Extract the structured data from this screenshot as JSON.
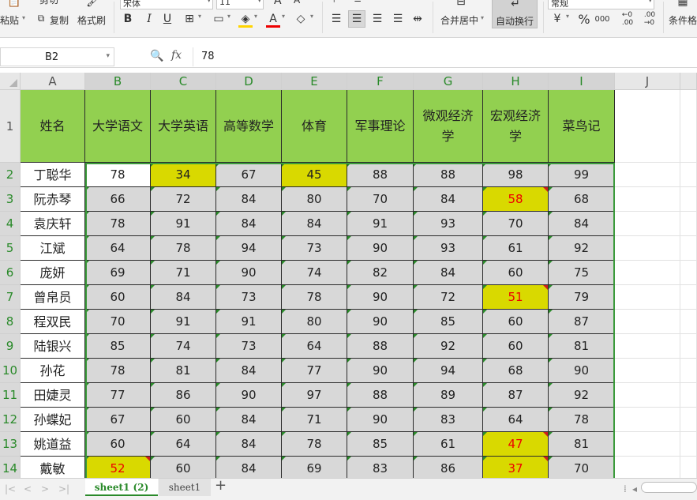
{
  "ribbon": {
    "paste_label": "粘贴",
    "cut_label": "剪切",
    "copy_label": "复制",
    "format_painter_label": "格式刷",
    "font_name": "宋体",
    "font_size": "11",
    "merge_center_label": "合并居中",
    "wrap_text_label": "自动换行",
    "number_format": "常规",
    "percent_symbol": "%",
    "cond_format_label": "条件格"
  },
  "formula_bar": {
    "name_box": "B2",
    "fx_label": "fx",
    "value": "78"
  },
  "columns": [
    "A",
    "B",
    "C",
    "D",
    "E",
    "F",
    "G",
    "H",
    "I",
    "J"
  ],
  "rows": [
    "1",
    "2",
    "3",
    "4",
    "5",
    "6",
    "7",
    "8",
    "9",
    "10",
    "11",
    "12",
    "13",
    "14"
  ],
  "headers": [
    "姓名",
    "大学语文",
    "大学英语",
    "高等数学",
    "体育",
    "军事理论",
    "微观经济学",
    "宏观经济学",
    "菜鸟记"
  ],
  "data": [
    {
      "name": "丁聪华",
      "scores": [
        "78",
        "34",
        "67",
        "45",
        "88",
        "88",
        "98",
        "99"
      ]
    },
    {
      "name": "阮赤琴",
      "scores": [
        "66",
        "72",
        "84",
        "80",
        "70",
        "84",
        "58",
        "68"
      ]
    },
    {
      "name": "袁庆轩",
      "scores": [
        "78",
        "91",
        "84",
        "84",
        "91",
        "93",
        "70",
        "84"
      ]
    },
    {
      "name": "江斌",
      "scores": [
        "64",
        "78",
        "94",
        "73",
        "90",
        "93",
        "61",
        "92"
      ]
    },
    {
      "name": "庞妍",
      "scores": [
        "69",
        "71",
        "90",
        "74",
        "82",
        "84",
        "60",
        "75"
      ]
    },
    {
      "name": "曾帛员",
      "scores": [
        "60",
        "84",
        "73",
        "78",
        "90",
        "72",
        "51",
        "79"
      ]
    },
    {
      "name": "程双民",
      "scores": [
        "70",
        "91",
        "91",
        "80",
        "90",
        "85",
        "60",
        "87"
      ]
    },
    {
      "name": "陆银兴",
      "scores": [
        "85",
        "74",
        "73",
        "64",
        "88",
        "92",
        "60",
        "81"
      ]
    },
    {
      "name": "孙花",
      "scores": [
        "78",
        "81",
        "84",
        "77",
        "90",
        "94",
        "68",
        "90"
      ]
    },
    {
      "name": "田婕灵",
      "scores": [
        "77",
        "86",
        "90",
        "97",
        "88",
        "89",
        "87",
        "92"
      ]
    },
    {
      "name": "孙蝶妃",
      "scores": [
        "67",
        "60",
        "84",
        "71",
        "90",
        "83",
        "64",
        "78"
      ]
    },
    {
      "name": "姚道益",
      "scores": [
        "60",
        "64",
        "84",
        "78",
        "85",
        "61",
        "47",
        "81"
      ]
    },
    {
      "name": "戴敏",
      "scores": [
        "52",
        "60",
        "84",
        "69",
        "83",
        "86",
        "37",
        "70"
      ]
    }
  ],
  "sheet_tabs": [
    "sheet1 (2)",
    "sheet1"
  ],
  "add_sheet": "+",
  "colors": {
    "header_fill": "#92d050",
    "highlight_fill": "#d9d900",
    "low_score_text": "#e00000",
    "selection_border": "#3b9a3b"
  }
}
